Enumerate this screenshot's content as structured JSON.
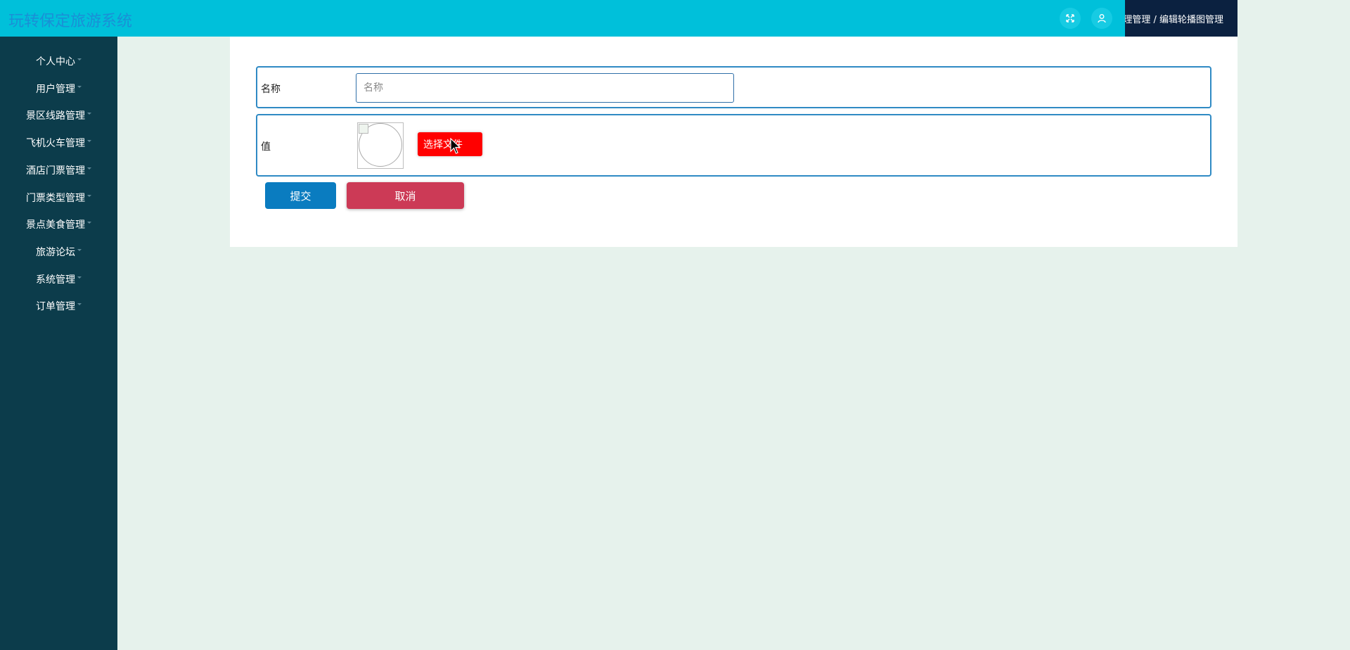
{
  "header": {
    "app_title": "玩转保定旅游系统",
    "icons": [
      "fullscreen-icon",
      "user-icon"
    ],
    "breadcrumb": "轮播图管理管理 / 编辑轮播图管理",
    "colors": {
      "topbar": "#00c0da",
      "breadcrumb_bg": "#0b2140"
    }
  },
  "sidebar": {
    "items": [
      {
        "label": "个人中心"
      },
      {
        "label": "用户管理"
      },
      {
        "label": "景区线路管理"
      },
      {
        "label": "飞机火车管理"
      },
      {
        "label": "酒店门票管理"
      },
      {
        "label": "门票类型管理"
      },
      {
        "label": "景点美食管理"
      },
      {
        "label": "旅游论坛"
      },
      {
        "label": "系统管理"
      },
      {
        "label": "订单管理"
      }
    ],
    "color": "#0c3c4b"
  },
  "form": {
    "name_label": "名称",
    "name_value": "",
    "name_placeholder": "名称",
    "value_label": "值",
    "file_button": "选择文件",
    "submit_label": "提交",
    "cancel_label": "取消",
    "colors": {
      "submit": "#0a7cc0",
      "cancel": "#cc3a56",
      "file_button": "#ff0000"
    }
  }
}
